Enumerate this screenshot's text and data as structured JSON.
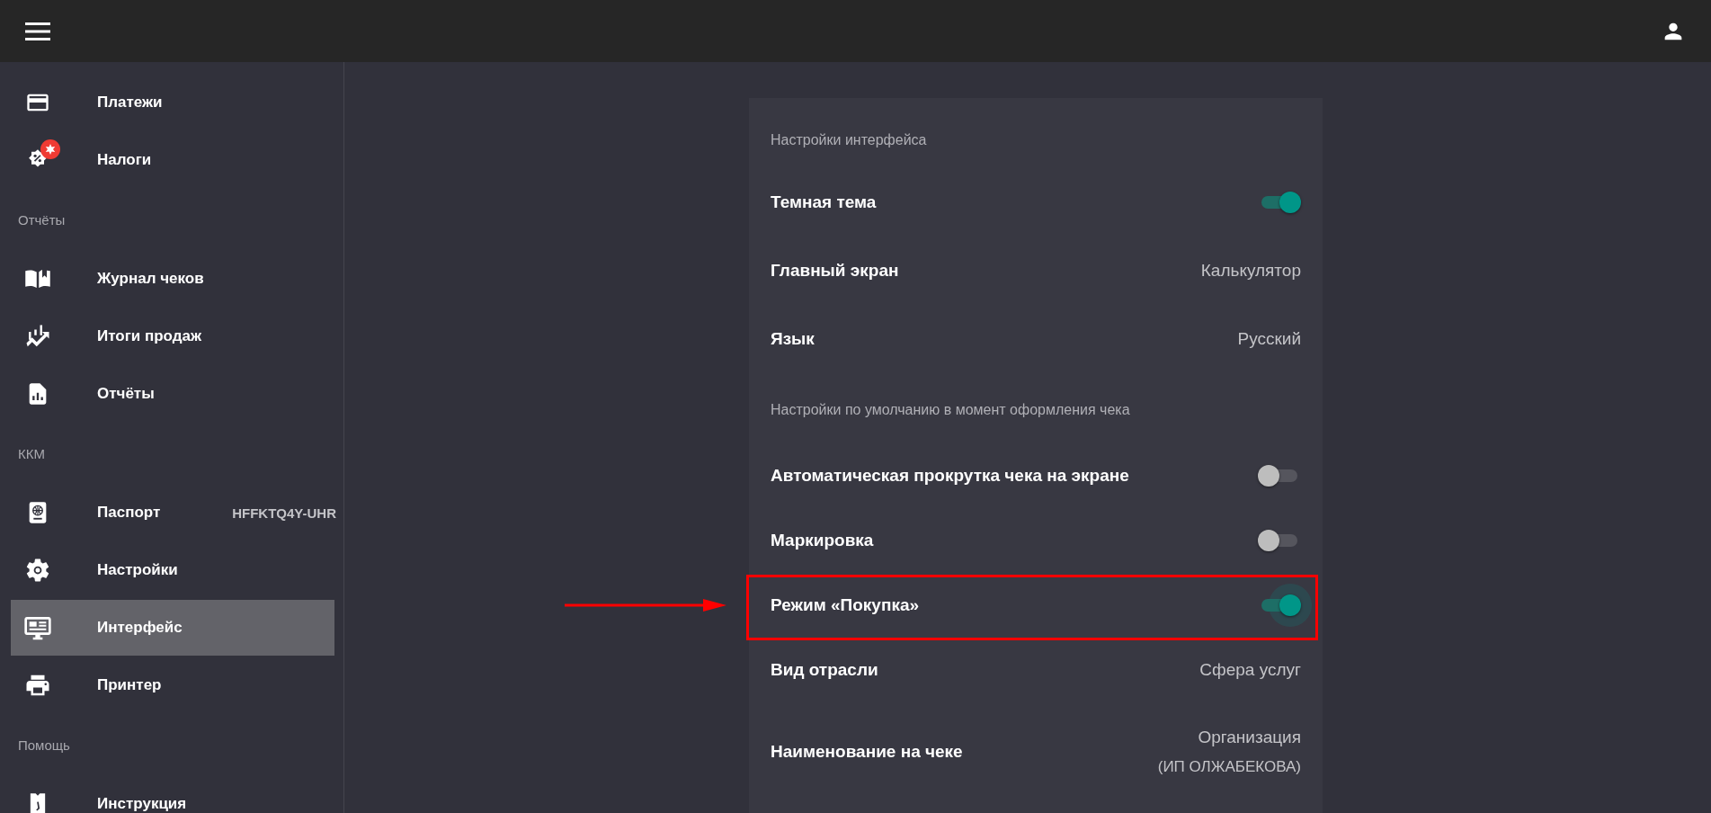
{
  "sidebar": {
    "items": [
      {
        "kind": "item",
        "label": "Платежи",
        "selected": false,
        "badge": false
      },
      {
        "kind": "item",
        "label": "Налоги",
        "selected": false,
        "badge": true
      },
      {
        "kind": "header",
        "label": "Отчёты"
      },
      {
        "kind": "item",
        "label": "Журнал чеков",
        "selected": false,
        "badge": false
      },
      {
        "kind": "item",
        "label": "Итоги продаж",
        "selected": false,
        "badge": false
      },
      {
        "kind": "item",
        "label": "Отчёты",
        "selected": false,
        "badge": false
      },
      {
        "kind": "header",
        "label": "ККМ"
      },
      {
        "kind": "item",
        "label": "Паспорт",
        "value": "HFFKTQ4Y-UHR",
        "selected": false,
        "badge": false
      },
      {
        "kind": "item",
        "label": "Настройки",
        "selected": false,
        "badge": false
      },
      {
        "kind": "item",
        "label": "Интерфейс",
        "selected": true,
        "badge": false
      },
      {
        "kind": "item",
        "label": "Принтер",
        "selected": false,
        "badge": false
      },
      {
        "kind": "header",
        "label": "Помощь"
      },
      {
        "kind": "item",
        "label": "Инструкция",
        "selected": false,
        "badge": false
      }
    ]
  },
  "settings": {
    "sections": [
      {
        "title": "Настройки интерфейса",
        "rows": [
          {
            "kind": "toggle",
            "label": "Темная тема",
            "on": true,
            "focused": false,
            "highlighted": false
          },
          {
            "kind": "value",
            "label": "Главный экран",
            "value": "Калькулятор",
            "highlighted": false
          },
          {
            "kind": "value",
            "label": "Язык",
            "value": "Русский",
            "highlighted": false
          }
        ]
      },
      {
        "title": "Настройки по умолчанию в момент оформления чека",
        "rows": [
          {
            "kind": "toggle",
            "label": "Автоматическая прокрутка чека на экране",
            "on": false,
            "focused": false,
            "highlighted": false
          },
          {
            "kind": "toggle",
            "label": "Маркировка",
            "on": false,
            "focused": false,
            "highlighted": false
          },
          {
            "kind": "toggle",
            "label": "Режим «Покупка»",
            "on": true,
            "focused": true,
            "highlighted": true
          },
          {
            "kind": "value",
            "label": "Вид отрасли",
            "value": "Сфера услуг",
            "highlighted": false
          },
          {
            "kind": "value",
            "label": "Наименование на чеке",
            "value": "Организация",
            "value_note": "(ИП ОЛЖАБЕКОВА)",
            "highlighted": false
          }
        ]
      }
    ]
  }
}
